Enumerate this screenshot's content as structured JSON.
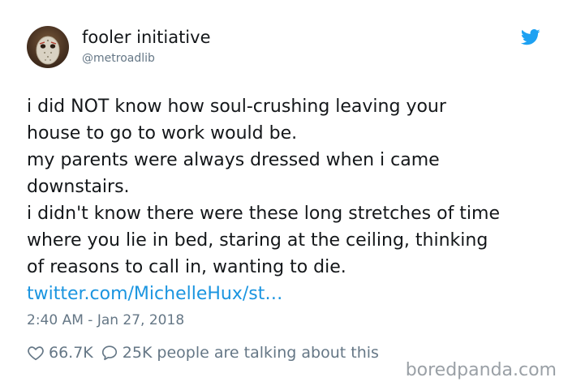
{
  "author": {
    "display_name": "fooler initiative",
    "handle": "@metroadlib",
    "avatar_icon": "hockey-mask-avatar"
  },
  "platform_icon": "twitter-bird-icon",
  "colors": {
    "brand_blue": "#1da1f2",
    "link": "#1b95e0",
    "text": "#14171a",
    "muted": "#657786"
  },
  "tweet": {
    "lines": [
      "i did NOT know how soul-crushing leaving your",
      "house to go to work would be.",
      "my parents were always dressed when i came",
      "downstairs.",
      "i didn't know there were these long stretches of time",
      "where you lie in bed, staring at the ceiling, thinking",
      "of reasons to call in, wanting to die."
    ],
    "link": "twitter.com/MichelleHux/st…",
    "timestamp": "2:40 AM - Jan 27, 2018"
  },
  "actions": {
    "like_icon": "heart-icon",
    "likes": "66.7K",
    "reply_icon": "speech-bubble-icon",
    "replies": "25K",
    "talking_text": "people are talking about this"
  },
  "watermark": "boredpanda.com"
}
